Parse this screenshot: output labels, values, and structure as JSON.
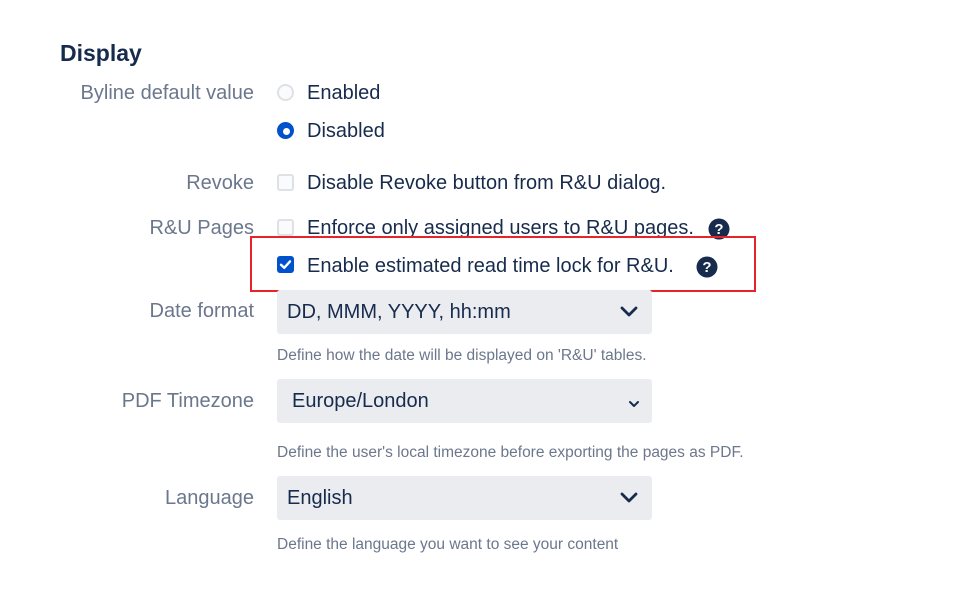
{
  "section": {
    "title": "Display"
  },
  "byline": {
    "label": "Byline default value",
    "options": [
      {
        "label": "Enabled",
        "checked": false
      },
      {
        "label": "Disabled",
        "checked": true
      }
    ]
  },
  "revoke": {
    "label": "Revoke",
    "option": {
      "label": "Disable Revoke button from R&U dialog.",
      "checked": false
    }
  },
  "ru_pages": {
    "label": "R&U Pages",
    "options": [
      {
        "label": "Enforce only assigned users to R&U pages.",
        "checked": false,
        "help_icon": "question-circle-icon"
      },
      {
        "label": "Enable estimated read time lock for R&U.",
        "checked": true,
        "help_icon": "question-circle-icon"
      }
    ]
  },
  "date_format": {
    "label": "Date format",
    "value": "DD, MMM, YYYY, hh:mm",
    "description": "Define how the date will be displayed on 'R&U' tables."
  },
  "pdf_timezone": {
    "label": "PDF Timezone",
    "value": "Europe/London",
    "description": "Define the user's local timezone before exporting the pages as PDF."
  },
  "language": {
    "label": "Language",
    "value": "English",
    "description": "Define the language you want to see your content"
  },
  "colors": {
    "accent": "#0052cc",
    "highlight_border": "#e5252a",
    "label_text": "#6b778c",
    "select_bg": "#ebecf0"
  }
}
